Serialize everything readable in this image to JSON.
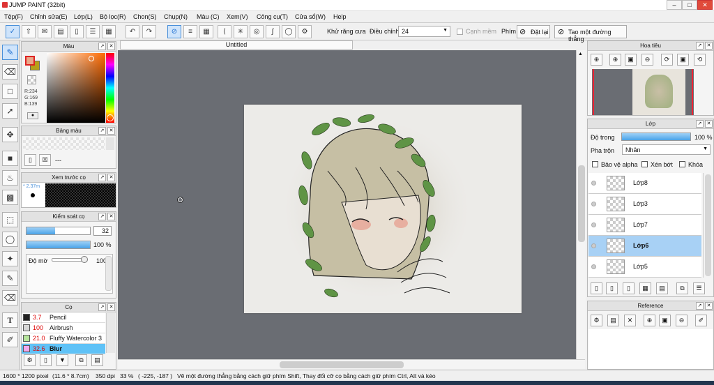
{
  "window": {
    "title": "JUMP PAINT (32bit)",
    "controls": [
      "–",
      "□",
      "✕"
    ]
  },
  "menu": [
    "Tệp(F)",
    "Chỉnh sửa(E)",
    "Lớp(L)",
    "Bộ lọc(R)",
    "Chon(S)",
    "Chụp(N)",
    "Màu (C)",
    "Xem(V)",
    "Công cụ(T)",
    "Cửa sổ(W)",
    "Help"
  ],
  "toolbar": {
    "antialias_label": "Khử răng cưa",
    "adjust_label": "Điều chỉnh",
    "adjust_value": "24",
    "soft_label": "Cạnh mềm",
    "key_label": "Phím",
    "reset_label": "Đặt lại",
    "line_label": "Tao một đường thẳng"
  },
  "color_panel": {
    "title": "Màu",
    "r": "R:234",
    "g": "G:169",
    "b": "B:139",
    "fg": "#e9a98b",
    "bg": "#b6a01a"
  },
  "palette_panel": {
    "title": "Bảng màu",
    "dash": "---"
  },
  "brush_preview": {
    "title": "Xem trước cọ",
    "size": "* 2.37m"
  },
  "brush_control": {
    "title": "Kiểm soát cọ",
    "size_value": "32",
    "size_fraction": 0.45,
    "opacity_value": "100 %",
    "opacity_fraction": 1.0,
    "blur_label": "Độ mờ",
    "blur_value": "100"
  },
  "brushes": {
    "title": "Cọ",
    "items": [
      {
        "size": "3.7",
        "name": "Pencil",
        "color": "#222222",
        "selected": false
      },
      {
        "size": "100",
        "name": "Airbrush",
        "color": "#d8d8d8",
        "selected": false
      },
      {
        "size": "21.0",
        "name": "Fluffy Watercolor 3",
        "color": "#b6e59c",
        "selected": false
      },
      {
        "size": "32.6",
        "name": "Blur",
        "color": "#f2a8ee",
        "selected": true
      }
    ]
  },
  "canvas": {
    "tab": "Untitled"
  },
  "navigator": {
    "title": "Hoa tiêu"
  },
  "layers": {
    "title": "Lớp",
    "opacity_label": "Độ trong",
    "opacity_value": "100 %",
    "opacity_fraction": 1.0,
    "blend_label": "Pha trộn",
    "blend_value": "Nhân",
    "protect_alpha": "Bảo vệ alpha",
    "clipping": "Xén bớt",
    "lock": "Khóa",
    "items": [
      {
        "name": "Lớp8",
        "selected": false
      },
      {
        "name": "Lớp3",
        "selected": false
      },
      {
        "name": "Lớp7",
        "selected": false
      },
      {
        "name": "Lớp6",
        "selected": true
      },
      {
        "name": "Lớp5",
        "selected": false
      }
    ]
  },
  "reference": {
    "title": "Reference"
  },
  "status": {
    "size": "1600 * 1200 pixel",
    "cm": "(11.6 * 8.7cm)",
    "dpi": "350 dpi",
    "zoom": "33 %",
    "coords": "( -225, -187 )",
    "hint": "Vẽ một đường thẳng bằng cách giữ phím Shift, Thay đổi cỡ cọ bằng cách giữ phím Ctrl, Alt và kéo"
  }
}
